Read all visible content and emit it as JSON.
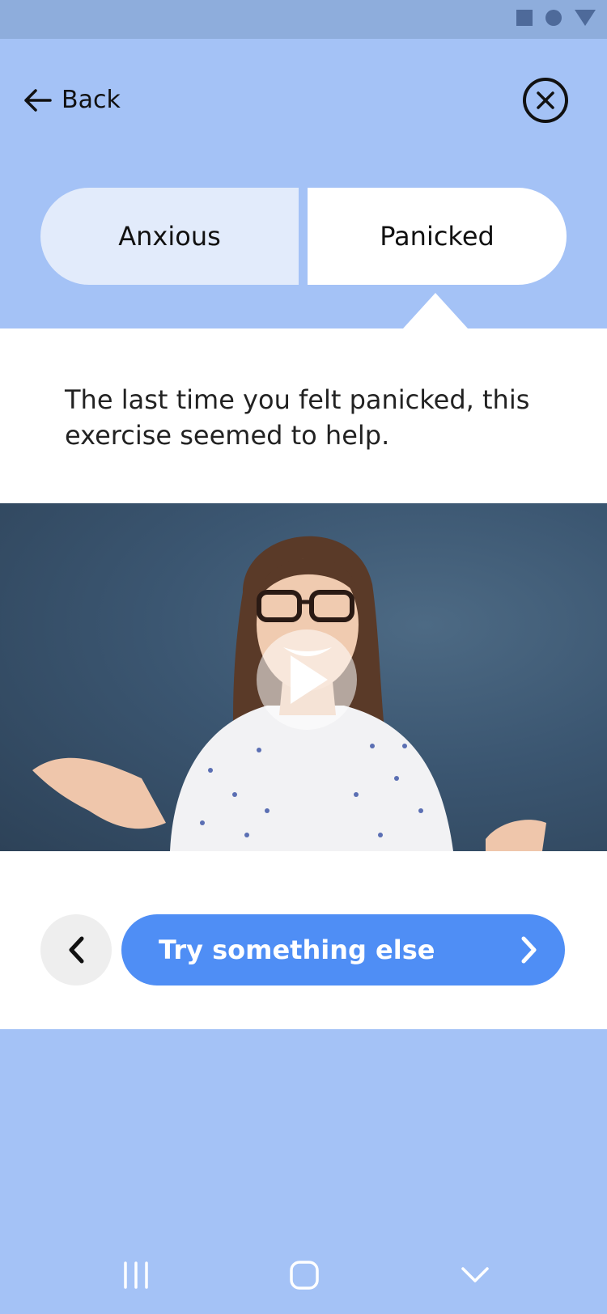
{
  "header": {
    "back_label": "Back"
  },
  "mood_tabs": [
    {
      "label": "Anxious",
      "selected": false
    },
    {
      "label": "Panicked",
      "selected": true
    }
  ],
  "message": "The last time you felt panicked, this exercise seemed to help.",
  "actions": {
    "primary_label": "Try something else"
  },
  "icons": {
    "back": "arrow-left-icon",
    "close": "close-circle-icon",
    "play": "play-icon",
    "prev": "chevron-left-icon",
    "next": "chevron-right-icon"
  },
  "colors": {
    "background": "#a4c2f6",
    "accent": "#4f8ef5",
    "card": "#ffffff"
  }
}
